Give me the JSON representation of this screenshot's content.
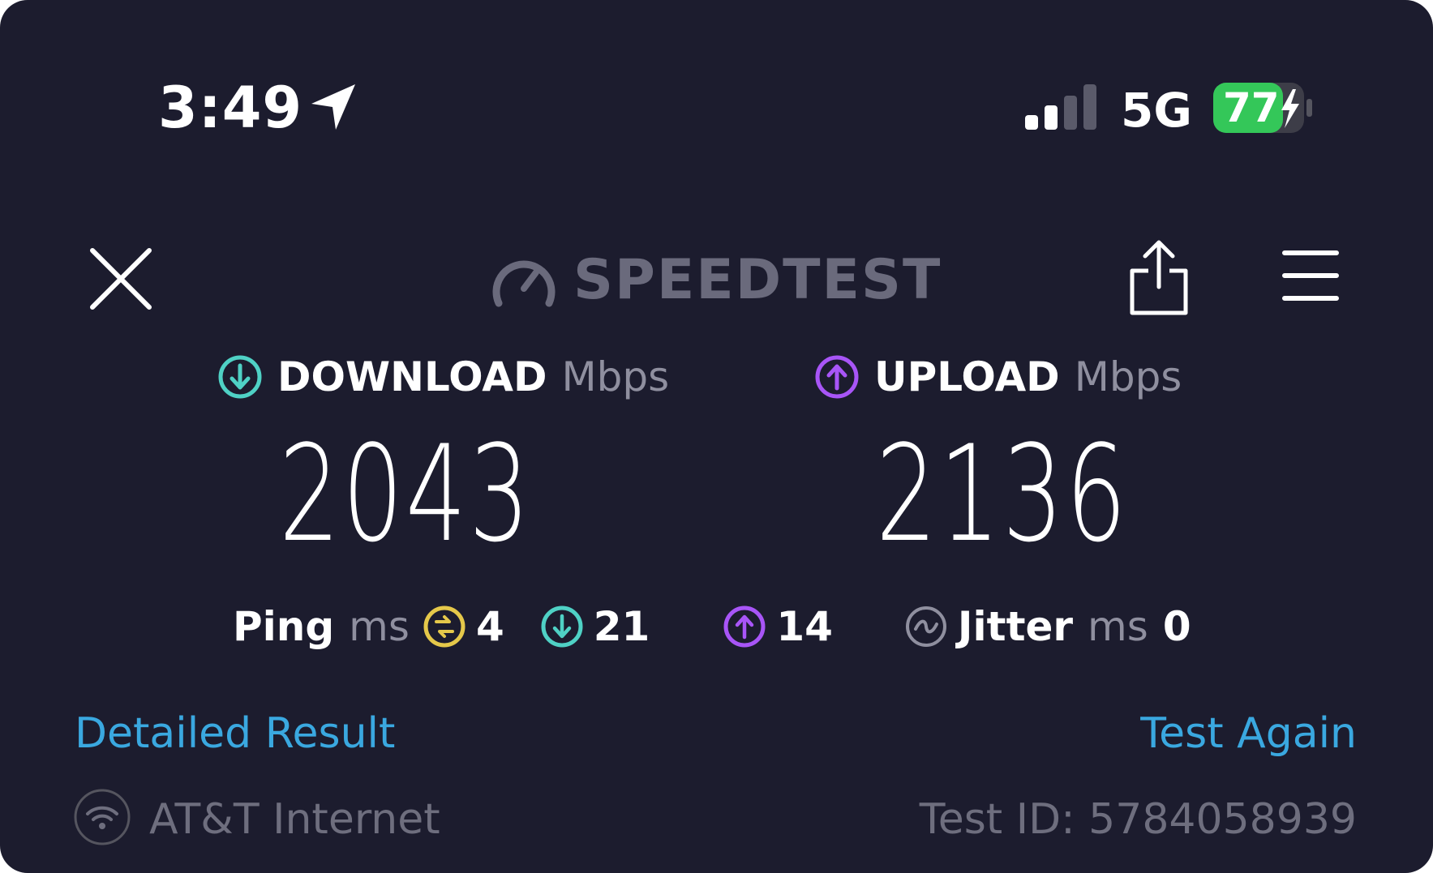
{
  "status_bar": {
    "time": "3:49",
    "network": "5G",
    "battery": "77",
    "battery_level": 0.77,
    "signal_bars": 2,
    "icons": [
      "location-arrow-icon",
      "cellular-signal-icon",
      "battery-charging-icon"
    ]
  },
  "header": {
    "brand": "SPEEDTEST",
    "icons": [
      "close-icon",
      "speedometer-icon",
      "share-icon",
      "hamburger-menu-icon"
    ]
  },
  "download": {
    "label": "DOWNLOAD",
    "unit": "Mbps",
    "value": "2043",
    "icon": "download-arrow-icon",
    "color": "#4fd1c5"
  },
  "upload": {
    "label": "UPLOAD",
    "unit": "Mbps",
    "value": "2136",
    "icon": "upload-arrow-icon",
    "color": "#a855f7"
  },
  "ping": {
    "label": "Ping",
    "unit": "ms",
    "idle": "4",
    "download": "21",
    "upload": "14",
    "idle_color": "#e5c84a"
  },
  "jitter": {
    "label": "Jitter",
    "unit": "ms",
    "value": "0"
  },
  "actions": {
    "detailed": "Detailed Result",
    "again": "Test Again",
    "link_color": "#3aa8e0"
  },
  "footer": {
    "provider": "AT&T Internet",
    "test_id": "Test ID: 5784058939",
    "icon": "wifi-icon"
  }
}
